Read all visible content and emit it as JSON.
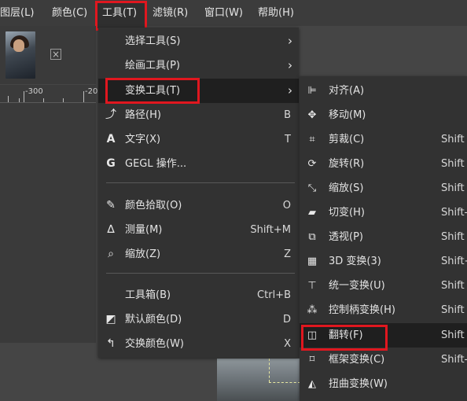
{
  "menubar": {
    "items": [
      "图层(L)",
      "颜色(C)",
      "工具(T)",
      "滤镜(R)",
      "窗口(W)",
      "帮助(H)"
    ],
    "active_index": 2
  },
  "ruler": {
    "labels": [
      "-300",
      "-20"
    ]
  },
  "tools_menu": {
    "items": [
      {
        "icon": "none",
        "label": "选择工具(S)",
        "shortcut": "",
        "submenu": true
      },
      {
        "icon": "none",
        "label": "绘画工具(P)",
        "shortcut": "",
        "submenu": true
      },
      {
        "icon": "none",
        "label": "变换工具(T)",
        "shortcut": "",
        "submenu": true,
        "highlighted": true
      },
      {
        "icon": "path-icon",
        "label": "路径(H)",
        "shortcut": "B"
      },
      {
        "icon": "text-icon",
        "label": "文字(X)",
        "shortcut": "T"
      },
      {
        "icon": "gegl-icon",
        "label": "GEGL 操作...",
        "shortcut": ""
      },
      {
        "icon": "color-picker-icon",
        "label": "颜色拾取(O)",
        "shortcut": "O"
      },
      {
        "icon": "measure-icon",
        "label": "测量(M)",
        "shortcut": "Shift+M"
      },
      {
        "icon": "zoom-icon",
        "label": "缩放(Z)",
        "shortcut": "Z"
      },
      {
        "icon": "none",
        "label": "工具箱(B)",
        "shortcut": "Ctrl+B"
      },
      {
        "icon": "default-colors-icon",
        "label": "默认颜色(D)",
        "shortcut": "D"
      },
      {
        "icon": "swap-colors-icon",
        "label": "交换颜色(W)",
        "shortcut": "X"
      }
    ]
  },
  "transform_submenu": {
    "items": [
      {
        "icon": "align-icon",
        "label": "对齐(A)",
        "shortcut": ""
      },
      {
        "icon": "move-icon",
        "label": "移动(M)",
        "shortcut": ""
      },
      {
        "icon": "crop-icon",
        "label": "剪裁(C)",
        "shortcut": "Shift"
      },
      {
        "icon": "rotate-icon",
        "label": "旋转(R)",
        "shortcut": "Shift"
      },
      {
        "icon": "scale-icon",
        "label": "缩放(S)",
        "shortcut": "Shift"
      },
      {
        "icon": "shear-icon",
        "label": "切变(H)",
        "shortcut": "Shift-"
      },
      {
        "icon": "perspective-icon",
        "label": "透视(P)",
        "shortcut": "Shift"
      },
      {
        "icon": "3d-transform-icon",
        "label": "3D 变换(3)",
        "shortcut": "Shift+"
      },
      {
        "icon": "unified-transform-icon",
        "label": "统一变换(U)",
        "shortcut": "Shift"
      },
      {
        "icon": "handle-transform-icon",
        "label": "控制柄变换(H)",
        "shortcut": "Shift"
      },
      {
        "icon": "flip-icon",
        "label": "翻转(F)",
        "shortcut": "Shift",
        "highlighted": true
      },
      {
        "icon": "cage-transform-icon",
        "label": "框架变换(C)",
        "shortcut": "Shift-"
      },
      {
        "icon": "warp-transform-icon",
        "label": "扭曲变换(W)",
        "shortcut": ""
      }
    ]
  },
  "colors": {
    "highlight_box": "#e0171f",
    "menu_bg": "#323232",
    "hover_bg": "#1f1f1f"
  }
}
